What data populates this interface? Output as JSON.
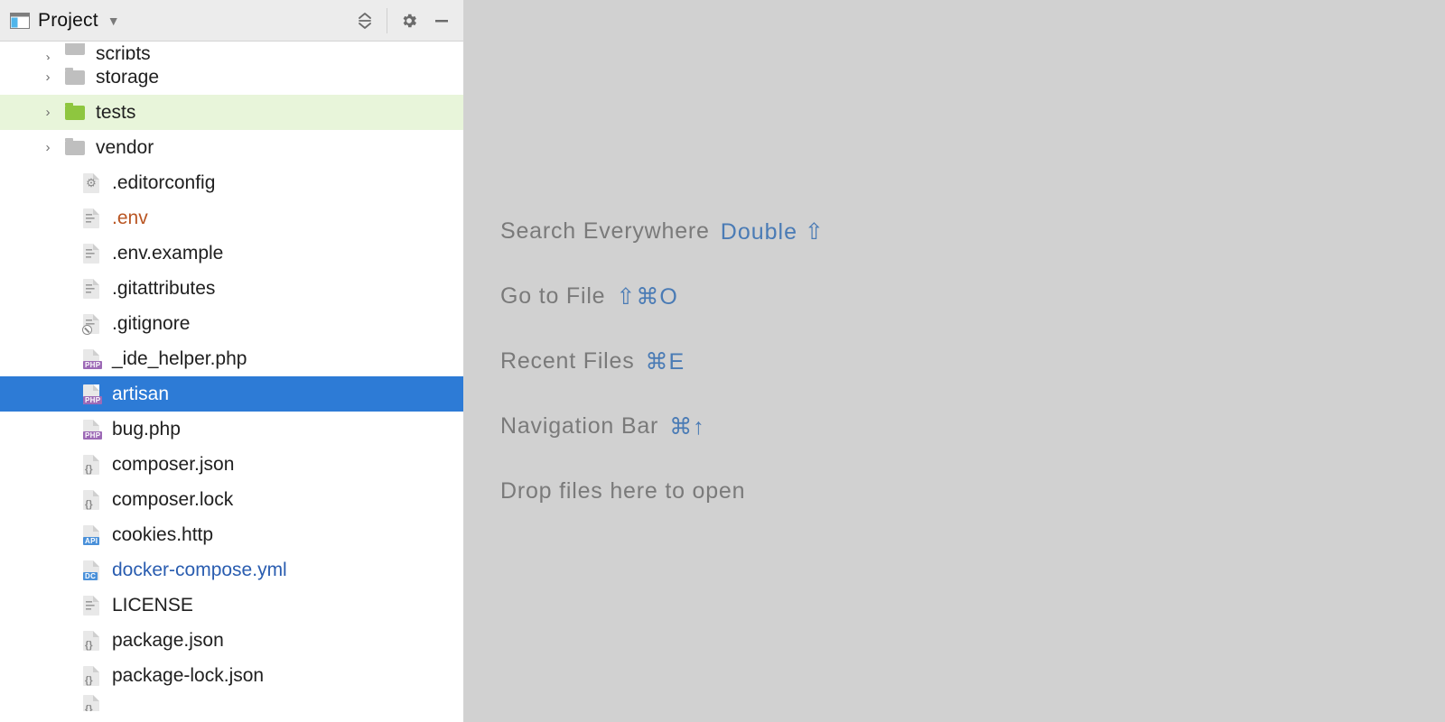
{
  "toolwindow": {
    "title": "Project"
  },
  "tree": [
    {
      "name": "scripts",
      "type": "folder",
      "expandable": true,
      "depth": 1,
      "partial": "top"
    },
    {
      "name": "storage",
      "type": "folder",
      "expandable": true,
      "depth": 1
    },
    {
      "name": "tests",
      "type": "folder",
      "expandable": true,
      "depth": 1,
      "hover": true,
      "folderColor": "green"
    },
    {
      "name": "vendor",
      "type": "folder",
      "expandable": true,
      "depth": 1
    },
    {
      "name": ".editorconfig",
      "type": "gear",
      "depth": 2
    },
    {
      "name": ".env",
      "type": "text",
      "depth": 2,
      "textColor": "orange"
    },
    {
      "name": ".env.example",
      "type": "text",
      "depth": 2
    },
    {
      "name": ".gitattributes",
      "type": "text",
      "depth": 2
    },
    {
      "name": ".gitignore",
      "type": "ignore",
      "depth": 2
    },
    {
      "name": "_ide_helper.php",
      "type": "php",
      "depth": 2
    },
    {
      "name": "artisan",
      "type": "php",
      "depth": 2,
      "selected": true
    },
    {
      "name": "bug.php",
      "type": "php",
      "depth": 2
    },
    {
      "name": "composer.json",
      "type": "json",
      "depth": 2
    },
    {
      "name": "composer.lock",
      "type": "json",
      "depth": 2
    },
    {
      "name": "cookies.http",
      "type": "api",
      "depth": 2
    },
    {
      "name": "docker-compose.yml",
      "type": "dc",
      "depth": 2,
      "textColor": "blue"
    },
    {
      "name": "LICENSE",
      "type": "text",
      "depth": 2
    },
    {
      "name": "package.json",
      "type": "json",
      "depth": 2
    },
    {
      "name": "package-lock.json",
      "type": "json",
      "depth": 2
    },
    {
      "name": "",
      "type": "json",
      "depth": 2,
      "partial": "bottom"
    }
  ],
  "editor_hints": [
    {
      "label": "Search Everywhere",
      "shortcut": "Double ⇧"
    },
    {
      "label": "Go to File",
      "shortcut": "⇧⌘O"
    },
    {
      "label": "Recent Files",
      "shortcut": "⌘E"
    },
    {
      "label": "Navigation Bar",
      "shortcut": "⌘↑"
    },
    {
      "label": "Drop files here to open",
      "shortcut": ""
    }
  ]
}
